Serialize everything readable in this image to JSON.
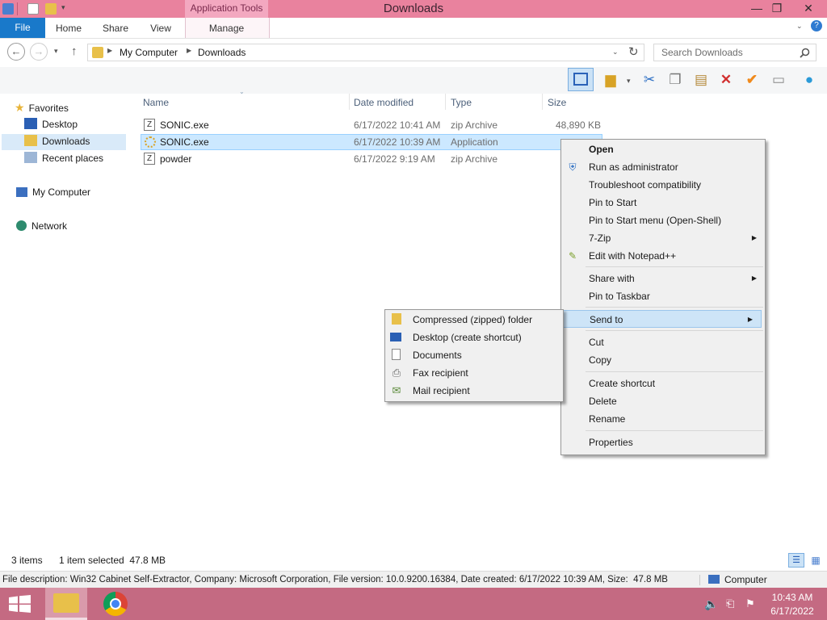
{
  "window": {
    "title": "Downloads",
    "contextual_tab_group": "Application Tools",
    "controls": {
      "minimize": "—",
      "maximize": "❐",
      "close": "✕"
    }
  },
  "ribbon": {
    "file_tab": "File",
    "tabs": [
      "Home",
      "Share",
      "View",
      "Manage"
    ]
  },
  "address": {
    "breadcrumb": [
      "My Computer",
      "Downloads"
    ],
    "search_placeholder": "Search Downloads"
  },
  "nav_pane": {
    "favorites": "Favorites",
    "favorites_items": [
      "Desktop",
      "Downloads",
      "Recent places"
    ],
    "my_computer": "My Computer",
    "network": "Network"
  },
  "file_list": {
    "columns": [
      "Name",
      "Date modified",
      "Type",
      "Size"
    ],
    "rows": [
      {
        "name": "SONIC.exe",
        "date": "6/17/2022 10:41 AM",
        "type": "zip Archive",
        "size": "48,890 KB"
      },
      {
        "name": "SONIC.exe",
        "date": "6/17/2022 10:39 AM",
        "type": "Application",
        "size": ""
      },
      {
        "name": "powder",
        "date": "6/17/2022 9:19 AM",
        "type": "zip Archive",
        "size": ""
      }
    ]
  },
  "context_menu": {
    "items": [
      "Open",
      "Run as administrator",
      "Troubleshoot compatibility",
      "Pin to Start",
      "Pin to Start menu (Open-Shell)",
      "7-Zip",
      "Edit with Notepad++",
      "Share with",
      "Pin to Taskbar",
      "Send to",
      "Cut",
      "Copy",
      "Create shortcut",
      "Delete",
      "Rename",
      "Properties"
    ]
  },
  "send_to_menu": {
    "items": [
      "Compressed (zipped) folder",
      "Desktop (create shortcut)",
      "Documents",
      "Fax recipient",
      "Mail recipient"
    ]
  },
  "status": {
    "item_count": "3 items",
    "selection": "1 item selected  47.8 MB",
    "description": "File description: Win32 Cabinet Self-Extractor, Company: Microsoft Corporation, File version: 10.0.9200.16384, Date created: 6/17/2022 10:39 AM, Size:  47.8 MB",
    "location": "Computer"
  },
  "taskbar": {
    "time": "10:43 AM",
    "date": "6/17/2022"
  },
  "colors": {
    "titlebar": "#e9829e",
    "taskbar": "#c46a82",
    "file_tab": "#1979ca",
    "selection": "#cce8ff",
    "menu_highlight": "#cde4f7"
  }
}
